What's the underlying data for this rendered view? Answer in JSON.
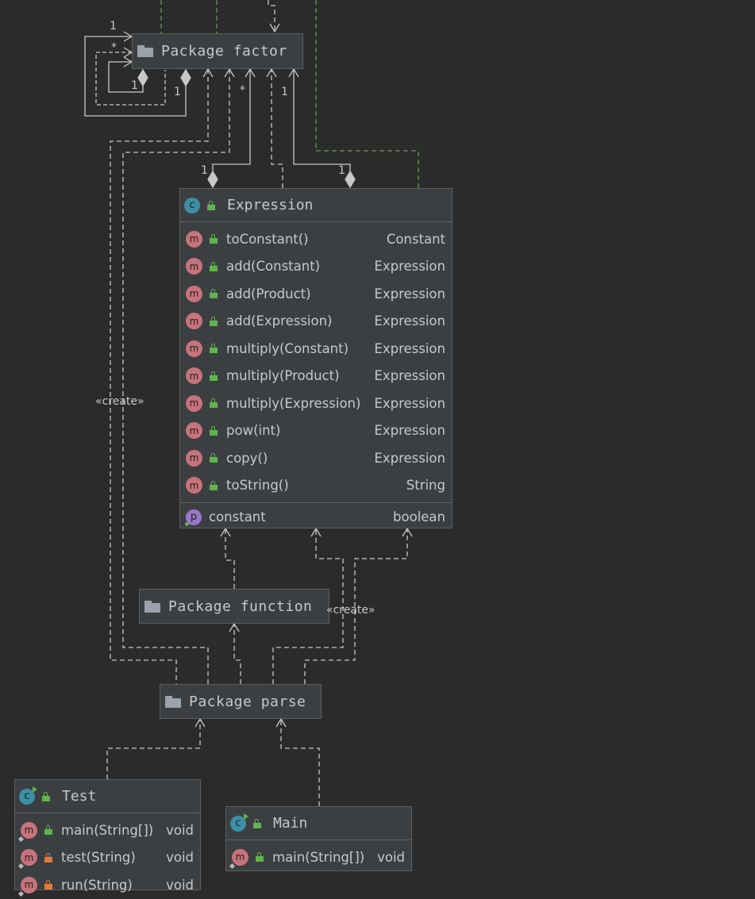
{
  "nodes": {
    "factor": {
      "label": "Package factor",
      "icon": "folder-icon"
    },
    "function": {
      "label": "Package function",
      "icon": "folder-icon"
    },
    "parse": {
      "label": "Package parse",
      "icon": "folder-icon"
    },
    "expression": {
      "name": "Expression",
      "kind_badge": "c",
      "methods": [
        {
          "sig": "toConstant()",
          "type": "Constant"
        },
        {
          "sig": "add(Constant)",
          "type": "Expression"
        },
        {
          "sig": "add(Product)",
          "type": "Expression"
        },
        {
          "sig": "add(Expression)",
          "type": "Expression"
        },
        {
          "sig": "multiply(Constant)",
          "type": "Expression"
        },
        {
          "sig": "multiply(Product)",
          "type": "Expression"
        },
        {
          "sig": "multiply(Expression)",
          "type": "Expression"
        },
        {
          "sig": "pow(int)",
          "type": "Expression"
        },
        {
          "sig": "copy()",
          "type": "Expression"
        },
        {
          "sig": "toString()",
          "type": "String"
        }
      ],
      "fields": [
        {
          "name": "constant",
          "type": "boolean",
          "badge": "p"
        }
      ],
      "method_badge": "m"
    },
    "test": {
      "name": "Test",
      "kind_badge": "c",
      "methods": [
        {
          "sig": "main(String[])",
          "type": "void",
          "visibility": "public"
        },
        {
          "sig": "test(String)",
          "type": "void",
          "visibility": "private"
        },
        {
          "sig": "run(String)",
          "type": "void",
          "visibility": "private"
        }
      ]
    },
    "main": {
      "name": "Main",
      "kind_badge": "c",
      "methods": [
        {
          "sig": "main(String[])",
          "type": "void",
          "visibility": "public"
        }
      ]
    }
  },
  "edge_labels": {
    "create_left": "«create»",
    "create_right": "«create»"
  },
  "multiplicities": {
    "self_top": "1",
    "self_star": "*",
    "self_inner": "1",
    "self_outer": "1",
    "factor_star": "*",
    "factor_one": "1",
    "expr_left": "1",
    "expr_right": "1"
  },
  "colors": {
    "background": "#2b2b2b",
    "node": "#3c3f41",
    "edge": "#c8c8c8",
    "realization": "#5fa04e"
  }
}
